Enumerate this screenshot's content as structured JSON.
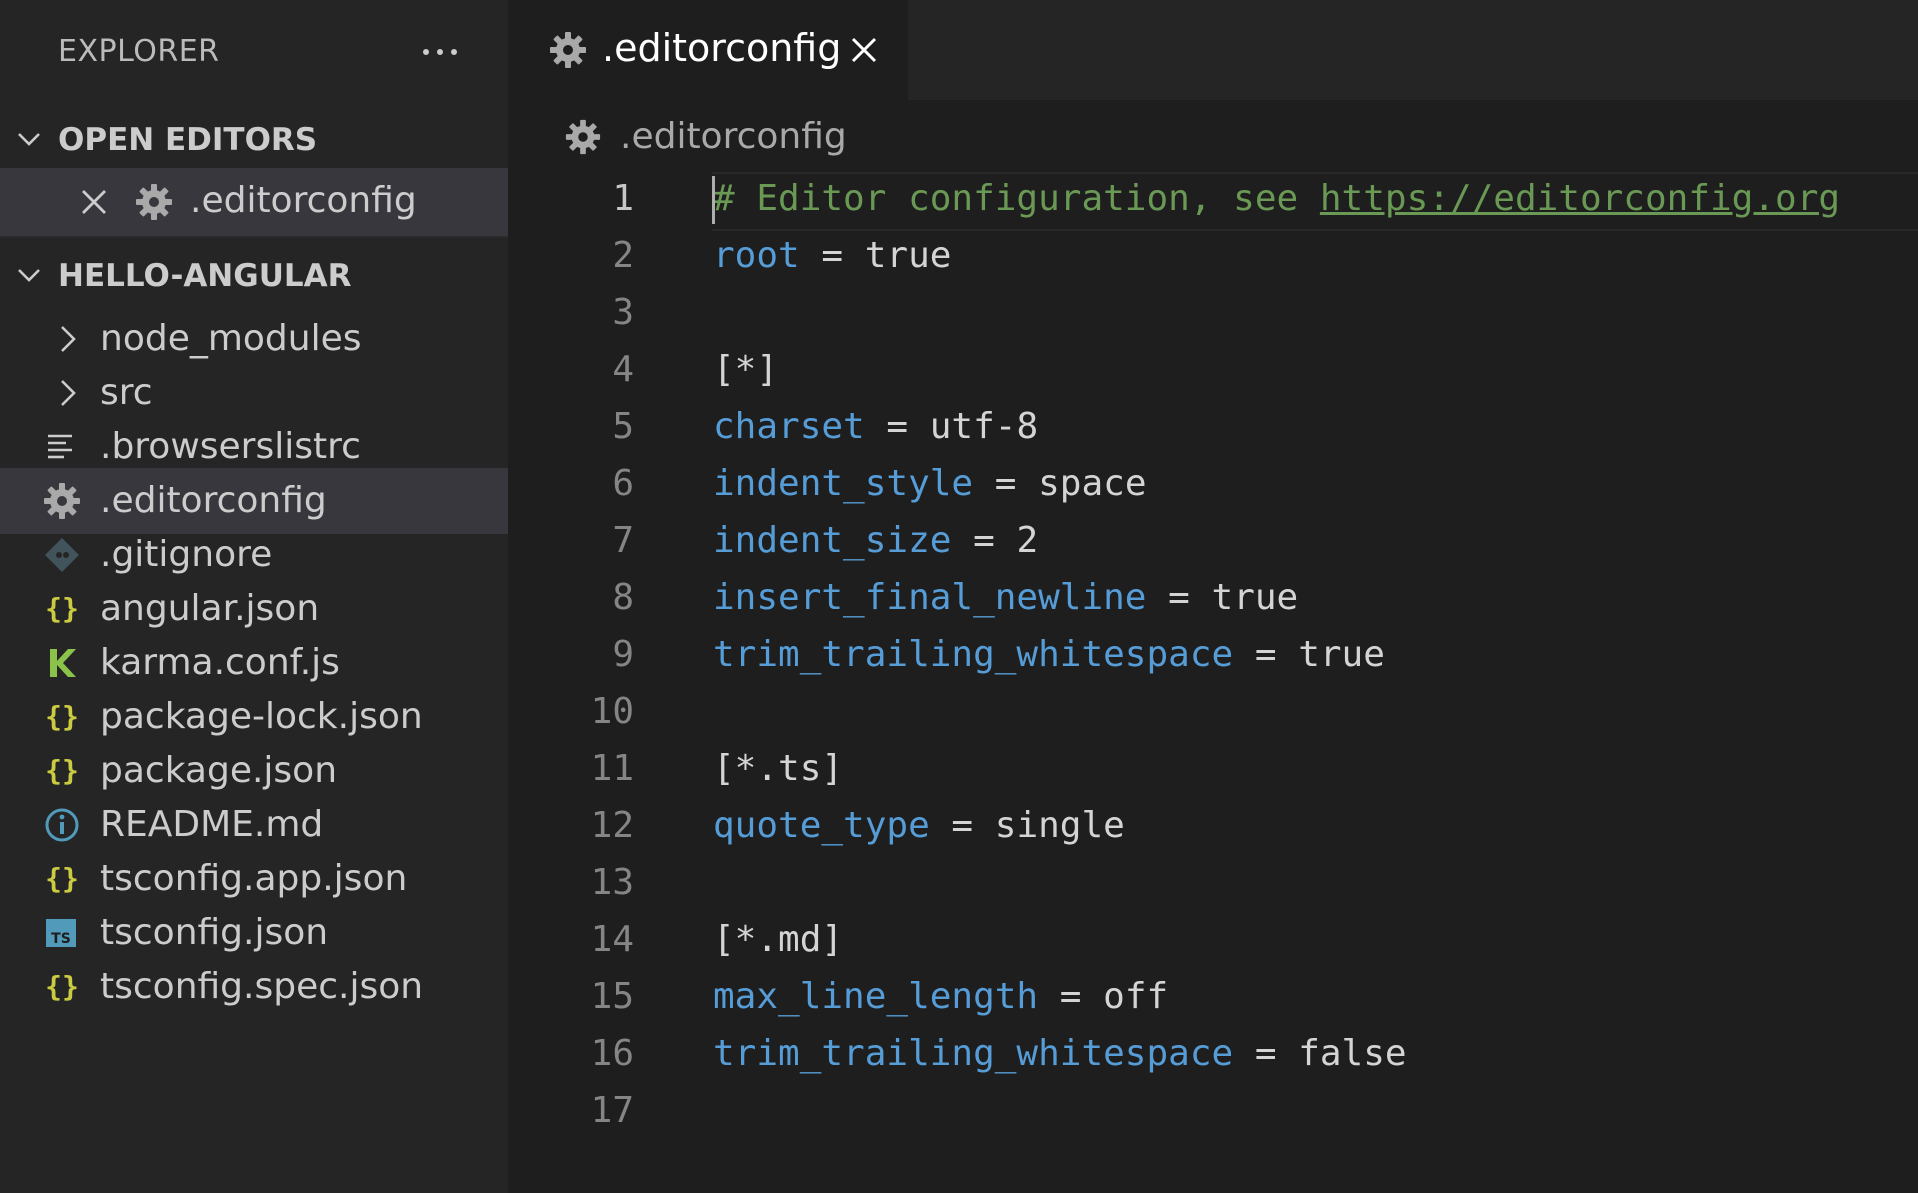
{
  "explorer": {
    "title": "EXPLORER",
    "more_icon": "ellipsis-icon"
  },
  "open_editors": {
    "header": "OPEN EDITORS",
    "items": [
      {
        "label": ".editorconfig",
        "icon": "gear-icon"
      }
    ]
  },
  "project": {
    "header": "HELLO-ANGULAR",
    "items": [
      {
        "label": "node_modules",
        "icon": "chevron-right-icon",
        "kind": "folder"
      },
      {
        "label": "src",
        "icon": "chevron-right-icon",
        "kind": "folder"
      },
      {
        "label": ".browserslistrc",
        "icon": "lines-icon",
        "kind": "file"
      },
      {
        "label": ".editorconfig",
        "icon": "gear-icon",
        "kind": "file",
        "selected": true
      },
      {
        "label": ".gitignore",
        "icon": "git-icon",
        "kind": "file"
      },
      {
        "label": "angular.json",
        "icon": "json-braces-icon",
        "kind": "file"
      },
      {
        "label": "karma.conf.js",
        "icon": "karma-icon",
        "kind": "file"
      },
      {
        "label": "package-lock.json",
        "icon": "json-braces-icon",
        "kind": "file"
      },
      {
        "label": "package.json",
        "icon": "json-braces-icon",
        "kind": "file"
      },
      {
        "label": "README.md",
        "icon": "info-icon",
        "kind": "file"
      },
      {
        "label": "tsconfig.app.json",
        "icon": "json-braces-icon",
        "kind": "file"
      },
      {
        "label": "tsconfig.json",
        "icon": "typescript-icon",
        "kind": "file"
      },
      {
        "label": "tsconfig.spec.json",
        "icon": "json-braces-icon",
        "kind": "file"
      }
    ]
  },
  "tab": {
    "label": ".editorconfig",
    "icon": "gear-icon"
  },
  "breadcrumb": {
    "label": ".editorconfig"
  },
  "editor": {
    "active_line": 1,
    "lines": [
      {
        "n": "1",
        "tokens": [
          {
            "t": "comment",
            "v": "# Editor configuration, see "
          },
          {
            "t": "link",
            "v": "https://editorconfig.org"
          }
        ]
      },
      {
        "n": "2",
        "tokens": [
          {
            "t": "key",
            "v": "root"
          },
          {
            "t": "eq",
            "v": " = "
          },
          {
            "t": "val",
            "v": "true"
          }
        ]
      },
      {
        "n": "3",
        "tokens": []
      },
      {
        "n": "4",
        "tokens": [
          {
            "t": "val",
            "v": "[*]"
          }
        ]
      },
      {
        "n": "5",
        "tokens": [
          {
            "t": "key",
            "v": "charset"
          },
          {
            "t": "eq",
            "v": " = "
          },
          {
            "t": "val",
            "v": "utf-8"
          }
        ]
      },
      {
        "n": "6",
        "tokens": [
          {
            "t": "key",
            "v": "indent_style"
          },
          {
            "t": "eq",
            "v": " = "
          },
          {
            "t": "val",
            "v": "space"
          }
        ]
      },
      {
        "n": "7",
        "tokens": [
          {
            "t": "key",
            "v": "indent_size"
          },
          {
            "t": "eq",
            "v": " = "
          },
          {
            "t": "val",
            "v": "2"
          }
        ]
      },
      {
        "n": "8",
        "tokens": [
          {
            "t": "key",
            "v": "insert_final_newline"
          },
          {
            "t": "eq",
            "v": " = "
          },
          {
            "t": "val",
            "v": "true"
          }
        ]
      },
      {
        "n": "9",
        "tokens": [
          {
            "t": "key",
            "v": "trim_trailing_whitespace"
          },
          {
            "t": "eq",
            "v": " = "
          },
          {
            "t": "val",
            "v": "true"
          }
        ]
      },
      {
        "n": "10",
        "tokens": []
      },
      {
        "n": "11",
        "tokens": [
          {
            "t": "val",
            "v": "[*.ts]"
          }
        ]
      },
      {
        "n": "12",
        "tokens": [
          {
            "t": "key",
            "v": "quote_type"
          },
          {
            "t": "eq",
            "v": " = "
          },
          {
            "t": "val",
            "v": "single"
          }
        ]
      },
      {
        "n": "13",
        "tokens": []
      },
      {
        "n": "14",
        "tokens": [
          {
            "t": "val",
            "v": "[*.md]"
          }
        ]
      },
      {
        "n": "15",
        "tokens": [
          {
            "t": "key",
            "v": "max_line_length"
          },
          {
            "t": "eq",
            "v": " = "
          },
          {
            "t": "val",
            "v": "off"
          }
        ]
      },
      {
        "n": "16",
        "tokens": [
          {
            "t": "key",
            "v": "trim_trailing_whitespace"
          },
          {
            "t": "eq",
            "v": " = "
          },
          {
            "t": "val",
            "v": "false"
          }
        ]
      },
      {
        "n": "17",
        "tokens": []
      }
    ]
  },
  "colors": {
    "sidebar_bg": "#252526",
    "editor_bg": "#1e1e1e",
    "selection_bg": "#37373d",
    "key": "#569cd6",
    "comment": "#6a9955",
    "json_icon": "#cbcb41",
    "karma_icon": "#8bc34a",
    "ts_icon": "#519aba"
  }
}
